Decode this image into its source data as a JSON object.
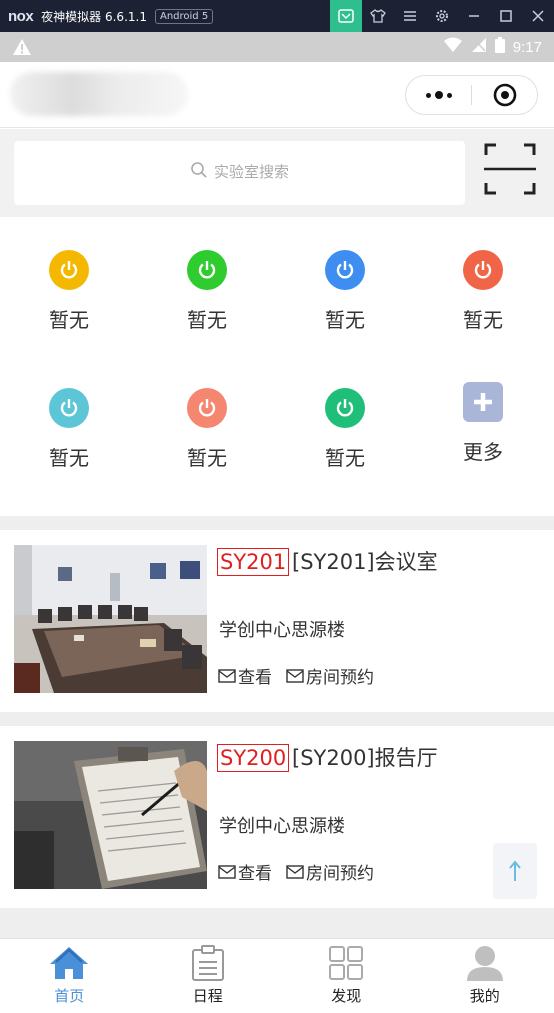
{
  "emulator": {
    "logo": "nox",
    "title": "夜神模拟器 6.6.1.1",
    "android_badge": "Android 5"
  },
  "status_bar": {
    "time": "9:17"
  },
  "search": {
    "placeholder": "实验室搜索"
  },
  "shortcuts": [
    {
      "label": "暂无",
      "color": "#f5b800",
      "icon": "power-icon"
    },
    {
      "label": "暂无",
      "color": "#2ecc2e",
      "icon": "power-icon"
    },
    {
      "label": "暂无",
      "color": "#3d8ef0",
      "icon": "power-icon"
    },
    {
      "label": "暂无",
      "color": "#f06548",
      "icon": "power-icon"
    },
    {
      "label": "暂无",
      "color": "#5cc6d6",
      "icon": "power-icon"
    },
    {
      "label": "暂无",
      "color": "#f58670",
      "icon": "power-icon"
    },
    {
      "label": "暂无",
      "color": "#1fbf7a",
      "icon": "power-icon"
    },
    {
      "label": "更多",
      "color": "#aab6d8",
      "icon": "plus-icon"
    }
  ],
  "rooms": [
    {
      "code": "SY201",
      "name": "[SY201]会议室",
      "building": "学创中心思源楼",
      "view_label": "查看",
      "book_label": "房间预约"
    },
    {
      "code": "SY200",
      "name": "[SY200]报告厅",
      "building": "学创中心思源楼",
      "view_label": "查看",
      "book_label": "房间预约"
    }
  ],
  "tabs": [
    {
      "label": "首页",
      "icon": "home-icon",
      "active": true
    },
    {
      "label": "日程",
      "icon": "clipboard-icon",
      "active": false
    },
    {
      "label": "发现",
      "icon": "grid-icon",
      "active": false
    },
    {
      "label": "我的",
      "icon": "user-icon",
      "active": false
    }
  ],
  "colors": {
    "accent": "#4a90d9",
    "room_code": "#e02020"
  }
}
